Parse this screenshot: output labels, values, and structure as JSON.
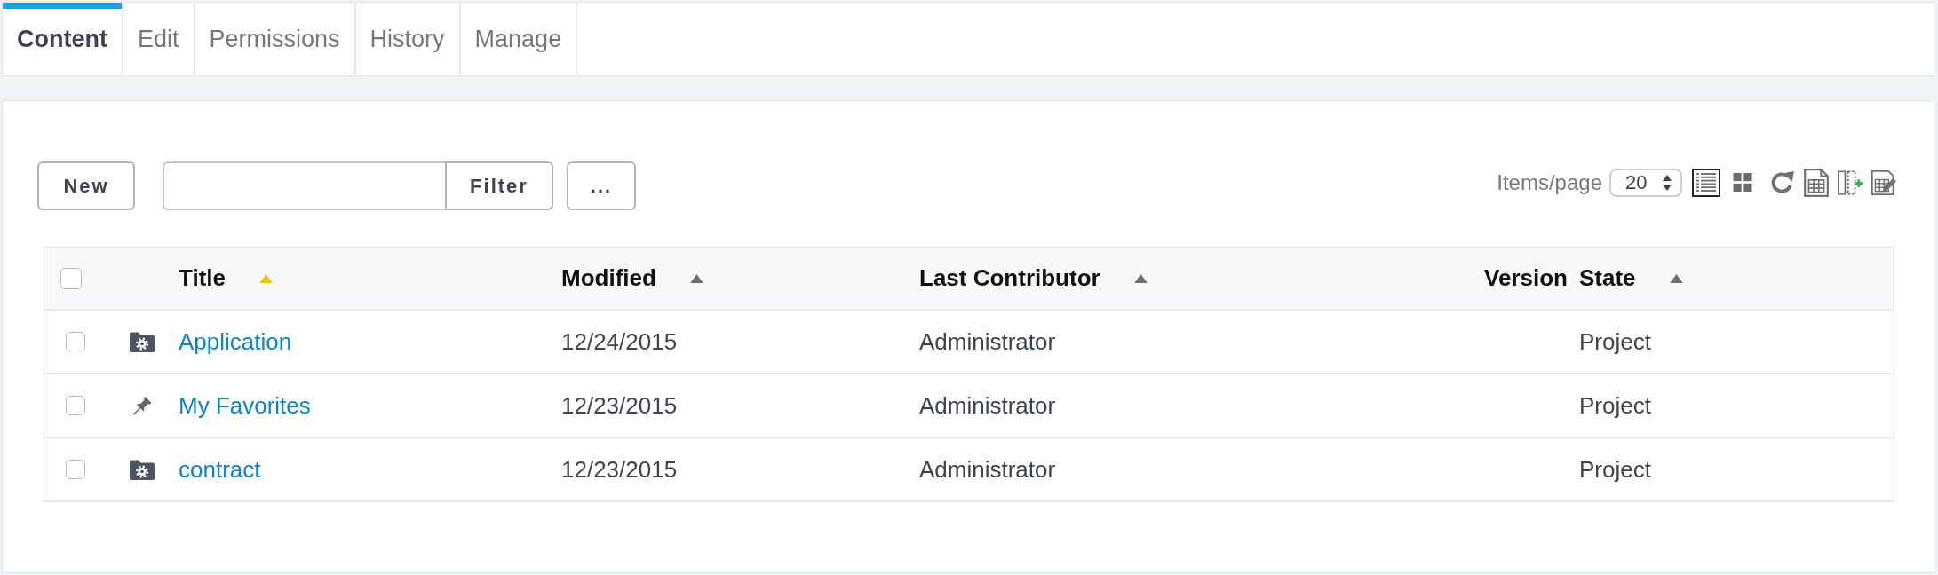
{
  "tabs": [
    {
      "label": "Content",
      "selected": true
    },
    {
      "label": "Edit",
      "selected": false
    },
    {
      "label": "Permissions",
      "selected": false
    },
    {
      "label": "History",
      "selected": false
    },
    {
      "label": "Manage",
      "selected": false
    }
  ],
  "toolbar": {
    "new_button": "New",
    "filter_button": "Filter",
    "more_button": "...",
    "items_per_page": {
      "label": "Items/page",
      "value": "20"
    },
    "view_modes": [
      {
        "kind": "list",
        "selected": true
      },
      {
        "kind": "grid",
        "selected": false
      }
    ]
  },
  "table": {
    "select_all": {
      "checked": false
    },
    "columns": [
      {
        "label": "Title",
        "sorted": true
      },
      {
        "label": "Modified",
        "sorted": false
      },
      {
        "label": "Last Contributor",
        "sorted": false
      },
      {
        "label": "Version"
      },
      {
        "label": "State",
        "sorted": false
      }
    ],
    "rows": [
      {
        "kind": "folder",
        "checked": false,
        "title": "Application",
        "modified": "12/24/2015",
        "last_contributor": "Administrator",
        "state": "Project"
      },
      {
        "kind": "pin",
        "checked": false,
        "title": "My Favorites",
        "modified": "12/23/2015",
        "last_contributor": "Administrator",
        "state": "Project"
      },
      {
        "kind": "folder",
        "checked": false,
        "title": "contract",
        "modified": "12/23/2015",
        "last_contributor": "Administrator",
        "state": "Project"
      }
    ]
  }
}
